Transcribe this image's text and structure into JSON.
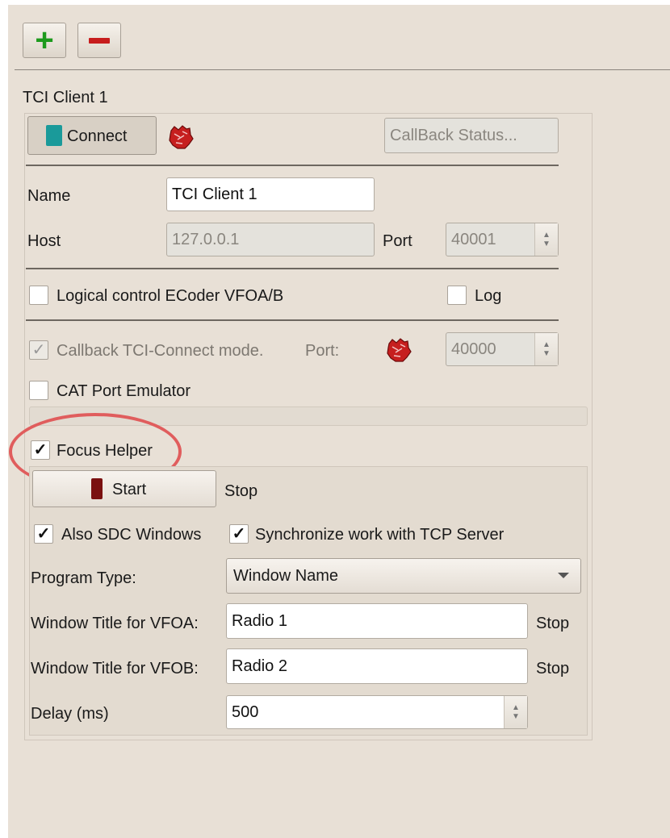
{
  "toolbar": {
    "add_icon": "plus-icon",
    "remove_icon": "minus-icon"
  },
  "client": {
    "group_title": "TCI Client 1",
    "connect_label": "Connect",
    "connect_led_color": "#1a9a9a",
    "callback_status_placeholder": "CallBack Status...",
    "name_label": "Name",
    "name_value": "TCI Client 1",
    "host_label": "Host",
    "host_value": "127.0.0.1",
    "port_label": "Port",
    "port_value": "40001",
    "logical_control_label": "Logical control ECoder VFOA/B",
    "logical_control_checked": false,
    "log_label": "Log",
    "log_checked": false,
    "callback_label": "Callback TCI-Connect mode.",
    "callback_checked": true,
    "callback_port_label": "Port:",
    "callback_port_value": "40000",
    "cat_label": "CAT Port Emulator",
    "cat_checked": false
  },
  "focus_helper": {
    "label": "Focus Helper",
    "checked": true,
    "start_label": "Start",
    "start_led_color": "#7a1010",
    "status_text": "Stop",
    "also_sdc_label": "Also SDC Windows",
    "also_sdc_checked": true,
    "sync_label": "Synchronize work with TCP Server",
    "sync_checked": true,
    "program_type_label": "Program Type:",
    "program_type_value": "Window Name",
    "vfoa_label": "Window Title for VFOA:",
    "vfoa_value": "Radio 1",
    "vfoa_status": "Stop",
    "vfob_label": "Window Title for VFOB:",
    "vfob_value": "Radio 2",
    "vfob_status": "Stop",
    "delay_label": "Delay (ms)",
    "delay_value": "500"
  },
  "colors": {
    "panel_bg": "#e8e0d6",
    "highlight_ring": "#e05d5d"
  }
}
